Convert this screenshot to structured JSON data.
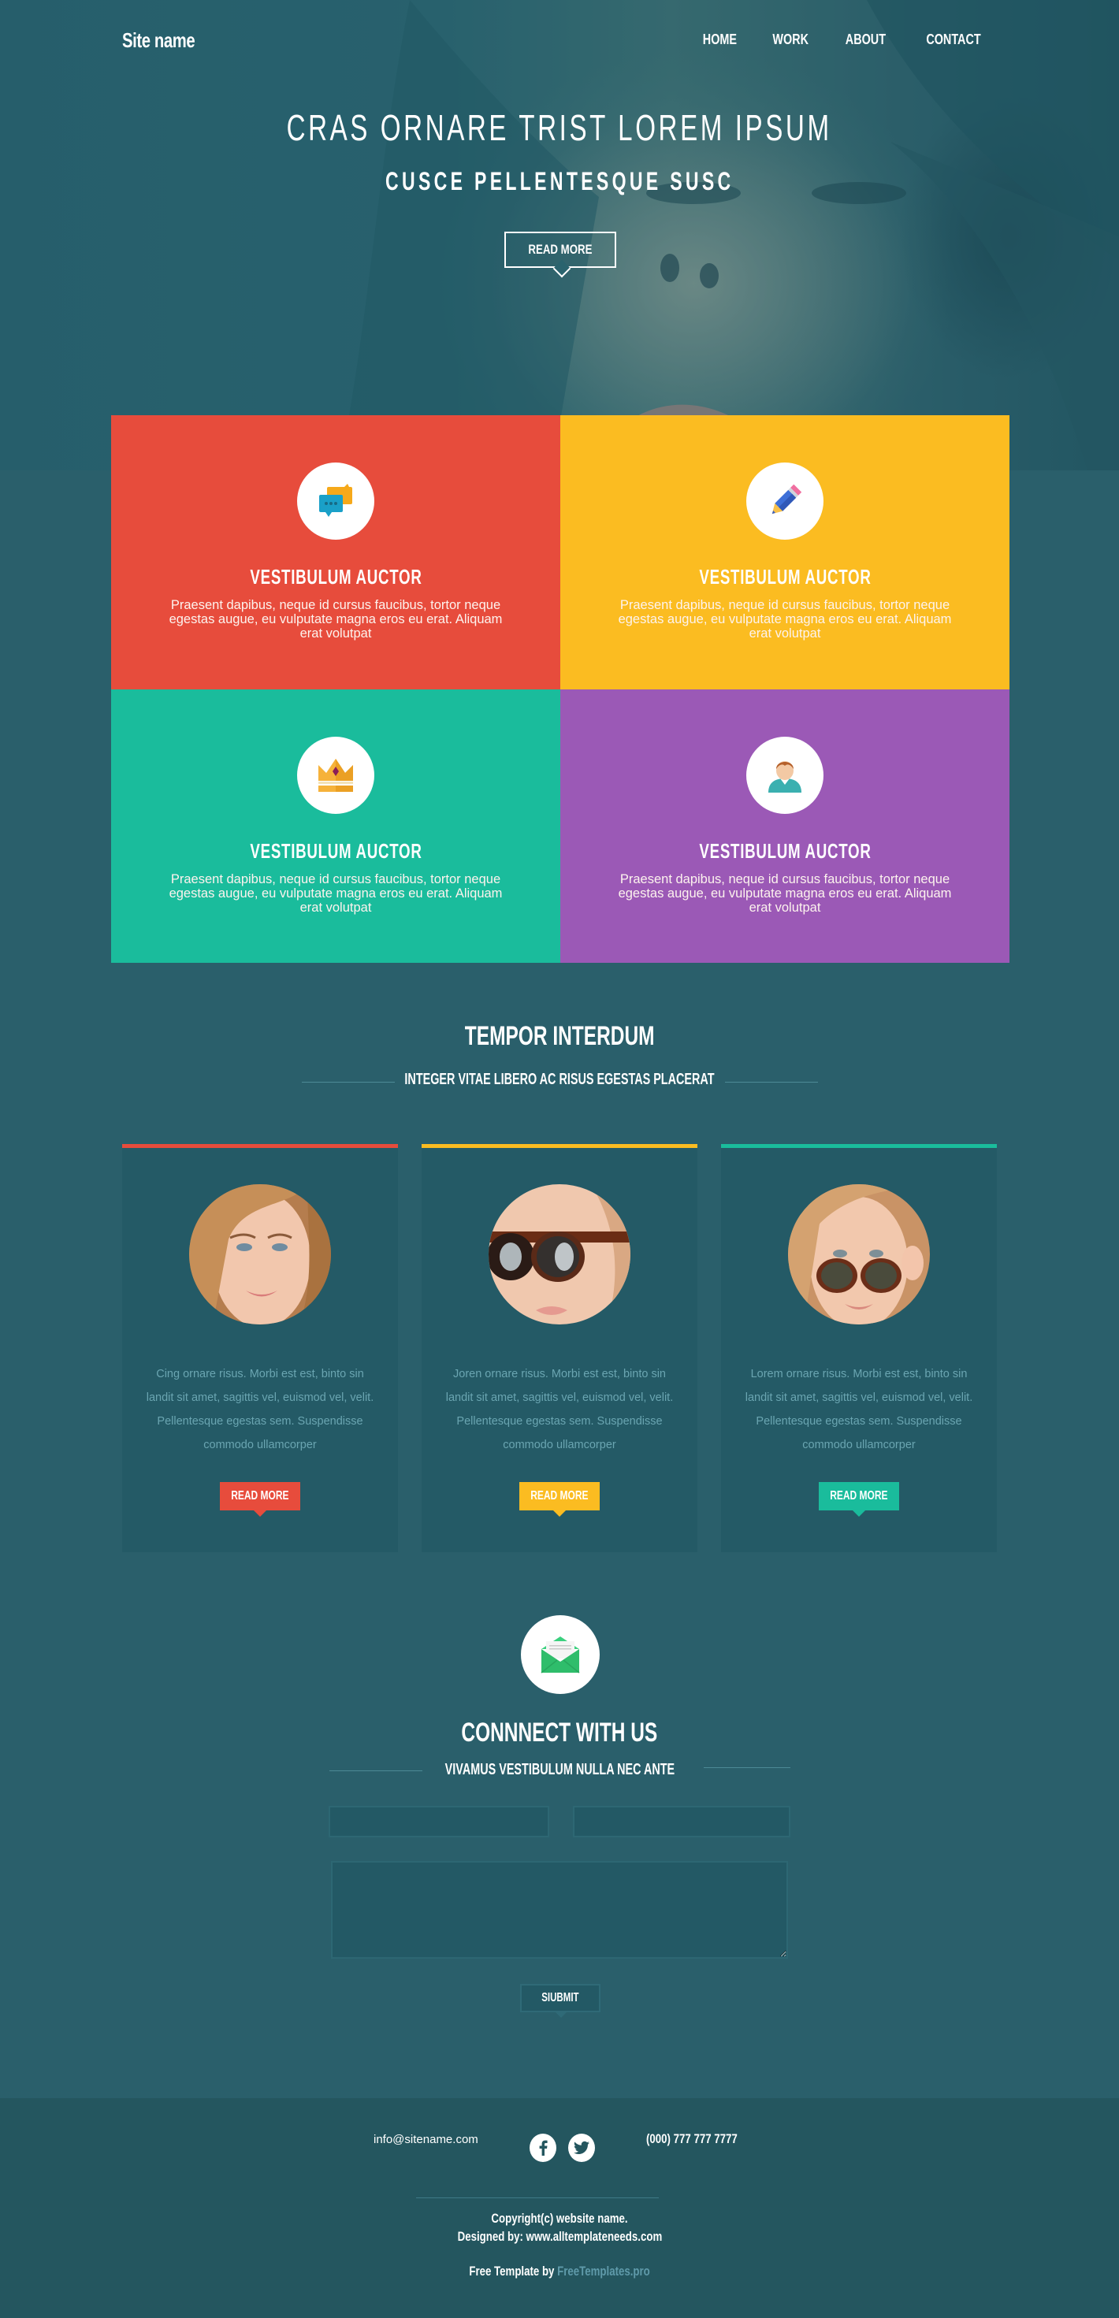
{
  "header": {
    "site_name": "Site name",
    "nav": [
      "HOME",
      "WORK",
      "ABOUT",
      "CONTACT"
    ]
  },
  "hero": {
    "title": "CRAS ORNARE TRIST LOREM IPSUM",
    "subtitle": "CUSCE PELLENTESQUE SUSC",
    "button_label": "READ MORE"
  },
  "features": [
    {
      "icon": "chat-bubbles-icon",
      "title": "VESTIBULUM AUCTOR",
      "text": "Praesent dapibus, neque id cursus faucibus, tortor neque egestas augue, eu vulputate magna eros eu erat. Aliquam erat volutpat",
      "color": "#e74c3c"
    },
    {
      "icon": "pencil-icon",
      "title": "VESTIBULUM AUCTOR",
      "text": "Praesent dapibus, neque id cursus faucibus, tortor neque egestas augue, eu vulputate magna eros eu erat. Aliquam erat volutpat",
      "color": "#fbbc21"
    },
    {
      "icon": "crown-icon",
      "title": "VESTIBULUM AUCTOR",
      "text": "Praesent dapibus, neque id cursus faucibus, tortor neque egestas augue, eu vulputate magna eros eu erat. Aliquam erat volutpat",
      "color": "#1abc9c"
    },
    {
      "icon": "user-icon",
      "title": "VESTIBULUM AUCTOR",
      "text": "Praesent dapibus, neque id cursus faucibus, tortor neque egestas augue, eu vulputate magna eros eu erat. Aliquam erat volutpat",
      "color": "#9b59b6"
    }
  ],
  "tempor": {
    "title": "TEMPOR INTERDUM",
    "subtitle": "INTEGER VITAE LIBERO AC RISUS EGESTAS PLACERAT",
    "cards": [
      {
        "accent": "#e74c3c",
        "text": "Cing ornare risus. Morbi est est, binto sin landit sit amet, sagittis vel, euismod vel, velit. Pellentesque egestas sem. Suspendisse commodo ullamcorper",
        "button_label": "READ MORE"
      },
      {
        "accent": "#fbbc21",
        "text": "Joren ornare risus. Morbi est est, binto sin landit sit amet, sagittis vel, euismod vel, velit. Pellentesque egestas sem. Suspendisse commodo ullamcorper",
        "button_label": "READ MORE"
      },
      {
        "accent": "#1abc9c",
        "text": "Lorem ornare risus. Morbi est est, binto sin landit sit amet, sagittis vel, euismod vel, velit. Pellentesque egestas sem. Suspendisse commodo ullamcorper",
        "button_label": "READ MORE"
      }
    ]
  },
  "contact": {
    "icon": "envelope-icon",
    "title": "CONNNECT WITH US",
    "subtitle": "VIVAMUS VESTIBULUM NULLA NEC ANTE",
    "name_value": "",
    "email_value": "",
    "message_value": "",
    "submit_label": "SIUBMIT"
  },
  "footer": {
    "email": "info@sitename.com",
    "social": [
      "facebook-icon",
      "twitter-icon"
    ],
    "phone": "(000) 777 777 7777",
    "copyright": "Copyright(c) website name.",
    "designed_by": "Designed by: www.alltemplateneeds.com",
    "free_template_prefix": "Free Template by ",
    "free_template_link": "FreeTemplates.pro"
  },
  "colors": {
    "page_bg": "#2a5f6b",
    "card_bg": "#245a66",
    "footer_bg": "#24565f",
    "red": "#e74c3c",
    "yellow": "#fbbc21",
    "teal": "#1abc9c",
    "purple": "#9b59b6",
    "link": "#5f9aaa"
  }
}
